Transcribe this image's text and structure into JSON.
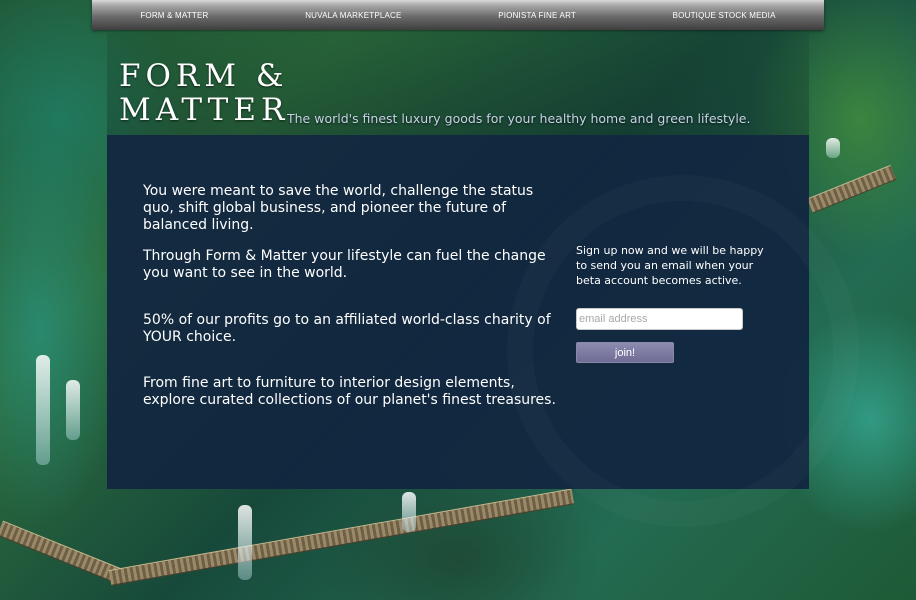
{
  "nav": {
    "items": [
      {
        "label": "FORM & MATTER"
      },
      {
        "label": "NUVALA MARKETPLACE"
      },
      {
        "label": "PIONISTA FINE ART"
      },
      {
        "label": "BOUTIQUE STOCK MEDIA"
      }
    ]
  },
  "header": {
    "logo_line1": "FORM &",
    "logo_line2": "MATTER",
    "tagline": "The world's finest luxury goods for your healthy home and green lifestyle."
  },
  "content": {
    "paragraphs": [
      "You were meant to save the world, challenge the status quo, shift global business, and pioneer the future of balanced living.",
      "Through Form & Matter your lifestyle can fuel the change you want to see in the world.",
      "50% of our profits go to an affiliated world-class charity of YOUR choice.",
      "From fine art to furniture to interior design elements, explore curated collections of our planet's finest treasures."
    ]
  },
  "signup": {
    "text": "Sign up now and we will be happy to send you an email when your beta account becomes active.",
    "email_placeholder": "email address",
    "email_value": "",
    "button_label": "join!"
  },
  "colors": {
    "panel": "#112540",
    "button": "#7a77a0",
    "tagline": "#c6d3e6"
  }
}
